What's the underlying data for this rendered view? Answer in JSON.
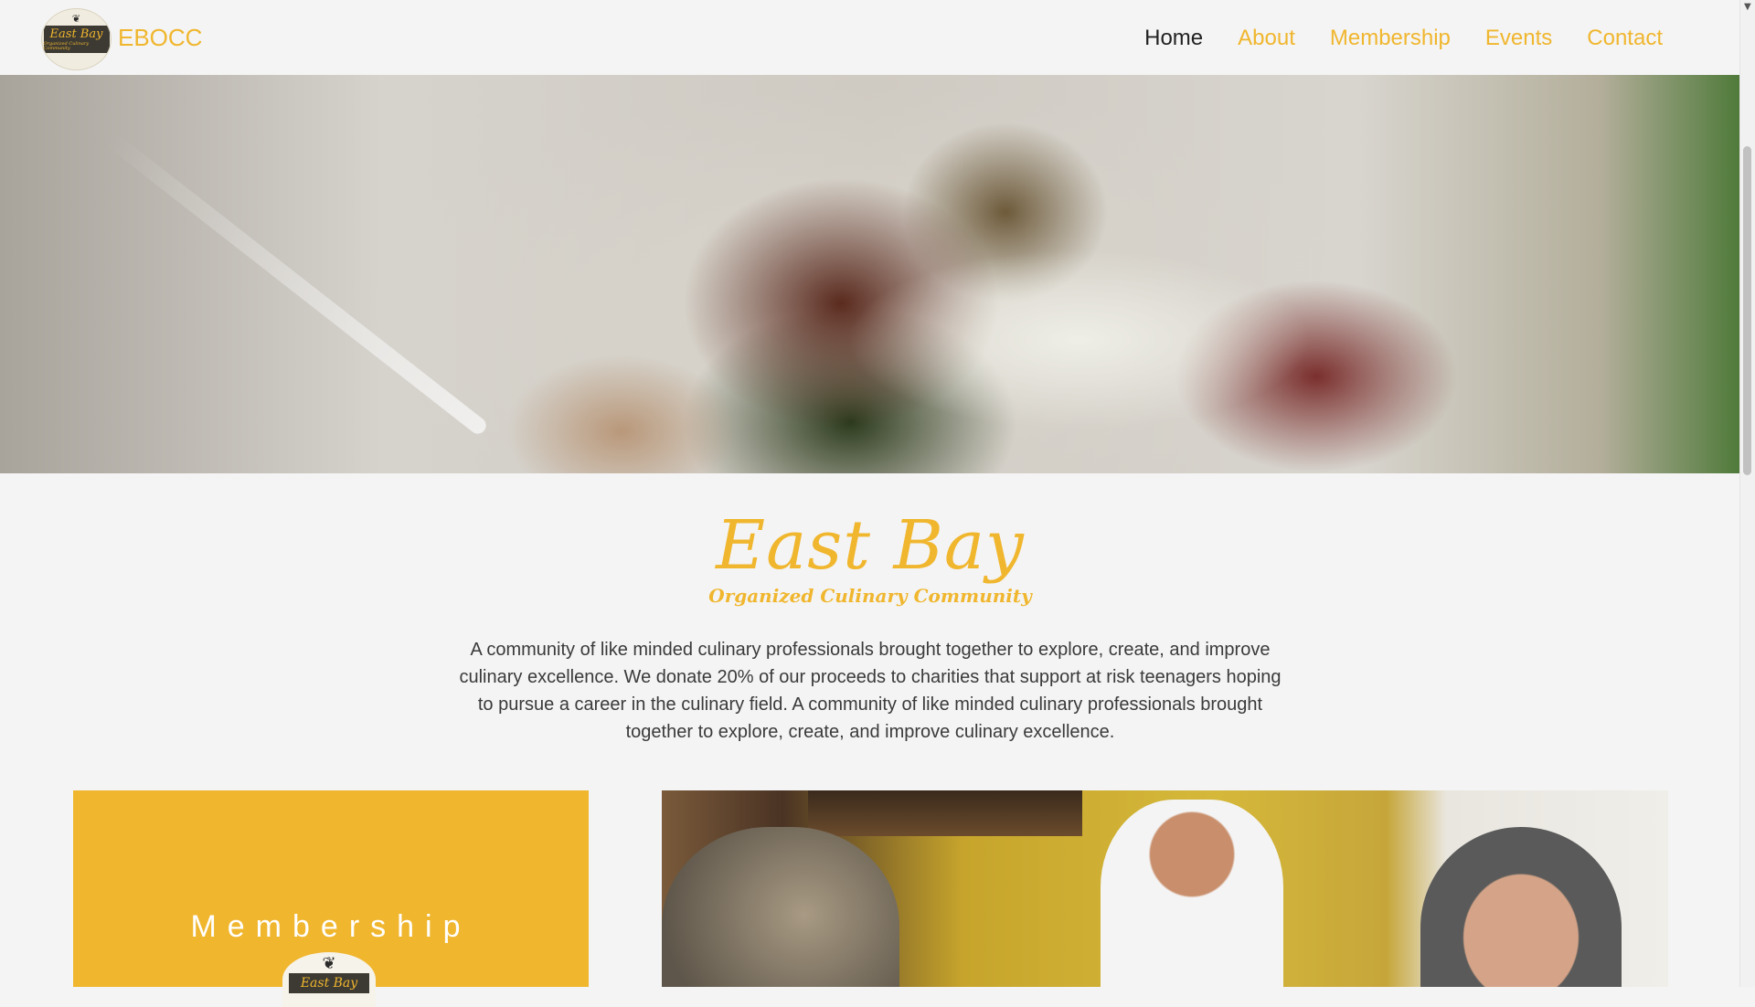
{
  "header": {
    "logo_text": "East Bay",
    "logo_subtext": "Organized Culinary Community",
    "site_name": "EBOCC",
    "nav": [
      {
        "label": "Home",
        "active": true
      },
      {
        "label": "About",
        "active": false
      },
      {
        "label": "Membership",
        "active": false
      },
      {
        "label": "Events",
        "active": false
      },
      {
        "label": "Contact",
        "active": false
      }
    ]
  },
  "hero": {
    "image": "plated dish with greens and roasted vegetables"
  },
  "intro": {
    "title": "East Bay",
    "subtitle": "Organized Culinary Community",
    "paragraph": "A community of like minded culinary professionals brought together to explore, create, and improve culinary excellence. We donate 20% of our proceeds to charities that support at risk teenagers hoping to pursue a career in the culinary field. A community of like minded culinary professionals brought together to explore, create, and improve culinary excellence."
  },
  "membership_card": {
    "label": "Membership",
    "logo_text": "East Bay"
  },
  "colors": {
    "accent": "#f0b62e",
    "text": "#3a3a3a",
    "active_nav": "#222222",
    "background": "#f4f4f4"
  },
  "icons": {
    "vine": "grape-vine-icon",
    "scroll_down": "scroll-down-arrow-icon"
  }
}
